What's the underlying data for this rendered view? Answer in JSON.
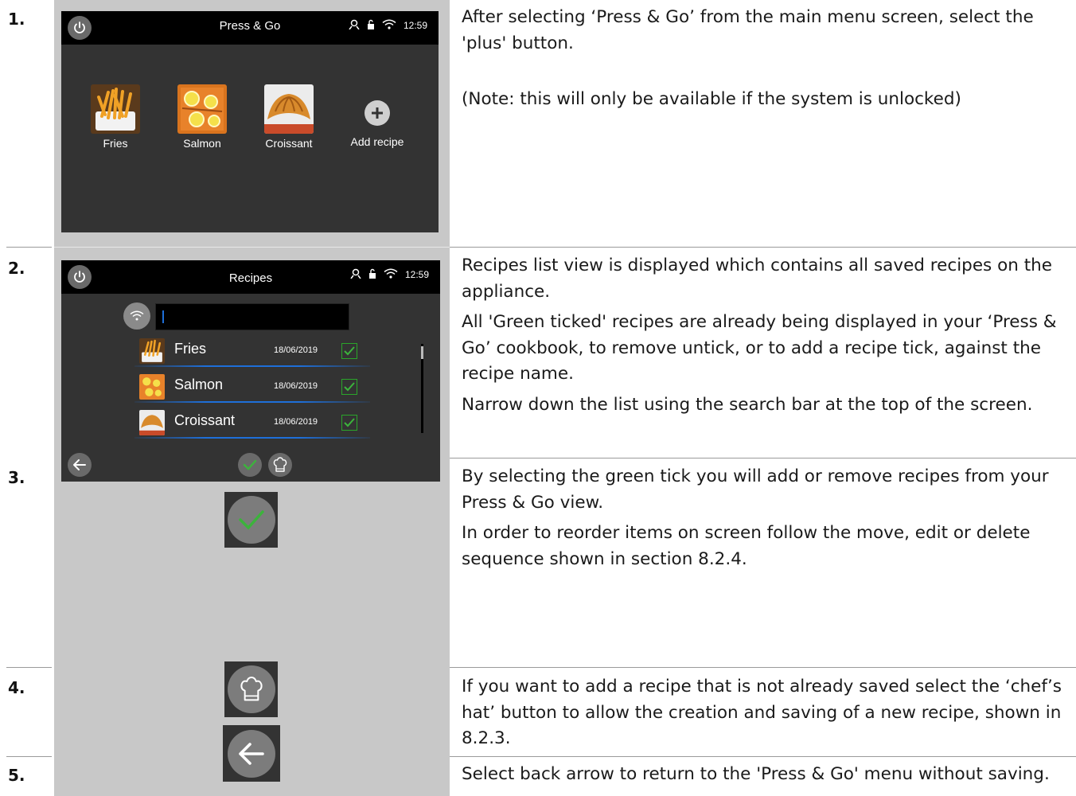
{
  "steps": [
    {
      "number": "1.",
      "paragraphs": [
        "After selecting ‘Press & Go’ from the main menu screen, select the 'plus' button.",
        "(Note: this will only be available if the system is unlocked)"
      ]
    },
    {
      "number": "2.",
      "paragraphs": [
        "Recipes list view is displayed which contains all saved recipes on the appliance.",
        "All 'Green ticked' recipes are already being displayed in your ‘Press & Go’ cookbook, to remove untick, or to add a recipe tick, against the recipe name.",
        "Narrow down the list using the search bar at the top of the screen."
      ]
    },
    {
      "number": "3.",
      "paragraphs": [
        "By selecting the green tick you will add or remove recipes from your Press & Go view.",
        "In order to reorder items on screen follow the move, edit or delete sequence shown in section 8.2.4."
      ]
    },
    {
      "number": "4.",
      "paragraphs": [
        "If you want to add a recipe that is not already saved select the ‘chef’s hat’ button to allow the creation and saving of a new recipe, shown in 8.2.3."
      ]
    },
    {
      "number": "5.",
      "paragraphs": [
        "Select back arrow to return to the 'Press & Go' menu without saving."
      ]
    }
  ],
  "screen1": {
    "title": "Press & Go",
    "time": "12:59",
    "tiles": [
      "Fries",
      "Salmon",
      "Croissant"
    ],
    "add_label": "Add recipe"
  },
  "screen2": {
    "title": "Recipes",
    "time": "12:59",
    "recipes": [
      {
        "name": "Fries",
        "date": "18/06/2019",
        "checked": true
      },
      {
        "name": "Salmon",
        "date": "18/06/2019",
        "checked": true
      },
      {
        "name": "Croissant",
        "date": "18/06/2019",
        "checked": true
      }
    ]
  },
  "colors": {
    "accent_green": "#3cb33c",
    "accent_blue": "#1e6fd9",
    "screen_bg": "#333333",
    "column_gray": "#c8c8c8"
  }
}
